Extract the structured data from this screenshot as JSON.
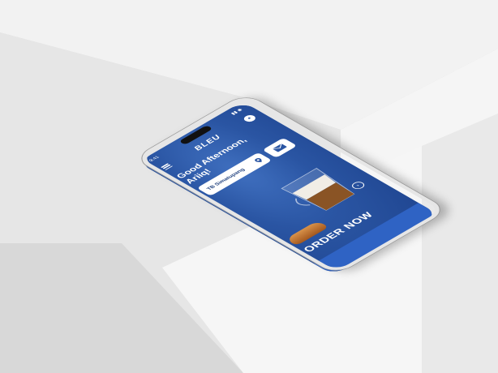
{
  "status": {
    "time": "9:41"
  },
  "header": {
    "logo": "BLEU"
  },
  "greeting": "Good Afternoon, Ariiq!",
  "location": {
    "label": "TB Simatupang"
  },
  "cta": {
    "label": "ORDER NOW"
  },
  "bottom_nav": {
    "items": [
      "",
      "",
      ""
    ]
  },
  "colors": {
    "primary": "#2a55a3",
    "card": "#ffffff",
    "background": "#dcdcdc"
  }
}
